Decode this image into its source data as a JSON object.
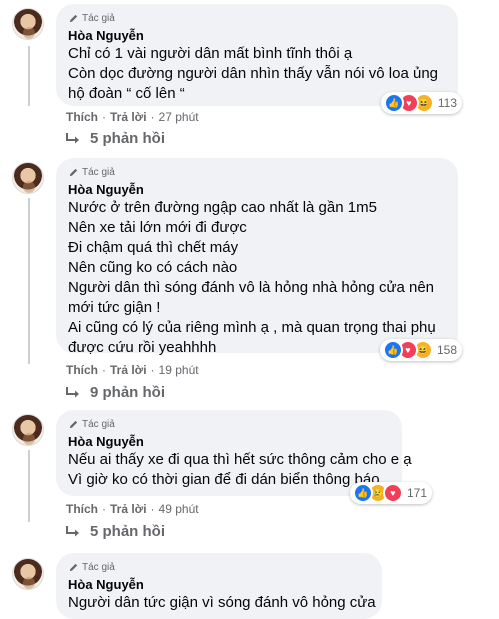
{
  "comments": [
    {
      "badge": "Tác giả",
      "author": "Hòa Nguyễn",
      "lines": [
        "Chỉ có 1 vài người dân mất bình tĩnh thôi ạ",
        "Còn dọc đường người dân nhìn thấy vẫn nói vô loa ủng",
        "hộ đoàn “ cố lên “"
      ],
      "reaction_icons": [
        "like-icon",
        "love-icon",
        "haha-icon"
      ],
      "reaction_count": "113",
      "like_label": "Thích",
      "reply_label": "Trả lời",
      "time": "27 phút",
      "replies_label": "5 phản hồi"
    },
    {
      "badge": "Tác giả",
      "author": "Hòa Nguyễn",
      "lines": [
        "Nước ở trên đường ngập cao nhất là gần 1m5",
        "Nên xe tải lớn mới đi được",
        "Đi chậm quá thì chết máy",
        "Nên cũng ko có cách nào",
        "Người dân thì sóng đánh vô là hỏng nhà hỏng cửa nên",
        "mới tức giận !",
        "Ai cũng có lý của riêng mình ạ , mà quan trọng thai phụ",
        "được cứu rồi yeahhhh"
      ],
      "reaction_icons": [
        "like-icon",
        "love-icon",
        "haha-icon"
      ],
      "reaction_count": "158",
      "like_label": "Thích",
      "reply_label": "Trả lời",
      "time": "19 phút",
      "replies_label": "9 phản hồi"
    },
    {
      "badge": "Tác giả",
      "author": "Hòa Nguyễn",
      "lines": [
        "Nếu ai thấy xe đi qua thì hết sức thông cảm cho e ạ",
        "Vì giờ ko có thời gian để đi dán biển thông báo"
      ],
      "reaction_icons": [
        "like-icon",
        "sad-icon",
        "love-icon"
      ],
      "reaction_count": "171",
      "like_label": "Thích",
      "reply_label": "Trả lời",
      "time": "49 phút",
      "replies_label": "5 phản hồi"
    },
    {
      "badge": "Tác giả",
      "author": "Hòa Nguyễn",
      "lines": [
        "Người dân tức giận vì sóng đánh vô hỏng cửa"
      ]
    }
  ]
}
